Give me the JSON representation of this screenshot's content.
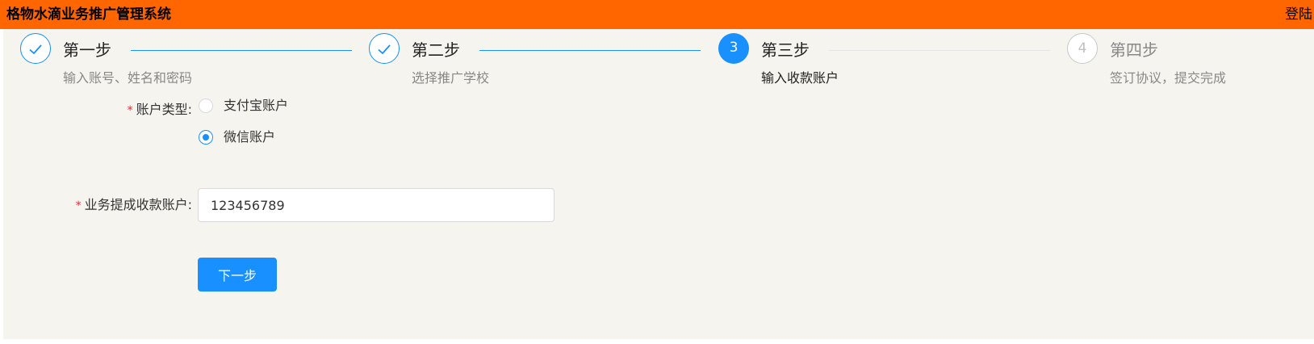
{
  "header": {
    "app_title": "格物水滴业务推广管理系统",
    "login_label": "登陆",
    "background_color": "#ff6600"
  },
  "steps": [
    {
      "number": "1",
      "title": "第一步",
      "description": "输入账号、姓名和密码",
      "status": "done",
      "icon": "check-icon"
    },
    {
      "number": "2",
      "title": "第二步",
      "description": "选择推广学校",
      "status": "done",
      "icon": "check-icon"
    },
    {
      "number": "3",
      "title": "第三步",
      "description": "输入收款账户",
      "status": "active"
    },
    {
      "number": "4",
      "title": "第四步",
      "description": "签订协议，提交完成",
      "status": "wait"
    }
  ],
  "form": {
    "account_type": {
      "label": "账户类型:",
      "required_mark": "*",
      "options": [
        {
          "label": "支付宝账户",
          "checked": false
        },
        {
          "label": "微信账户",
          "checked": true
        }
      ]
    },
    "collection_account": {
      "label": "业务提成收款账户:",
      "required_mark": "*",
      "value": "123456789"
    },
    "next_button_label": "下一步"
  },
  "colors": {
    "primary": "#1890ff",
    "content_background": "#f5f4ee",
    "required": "#f5222d"
  }
}
